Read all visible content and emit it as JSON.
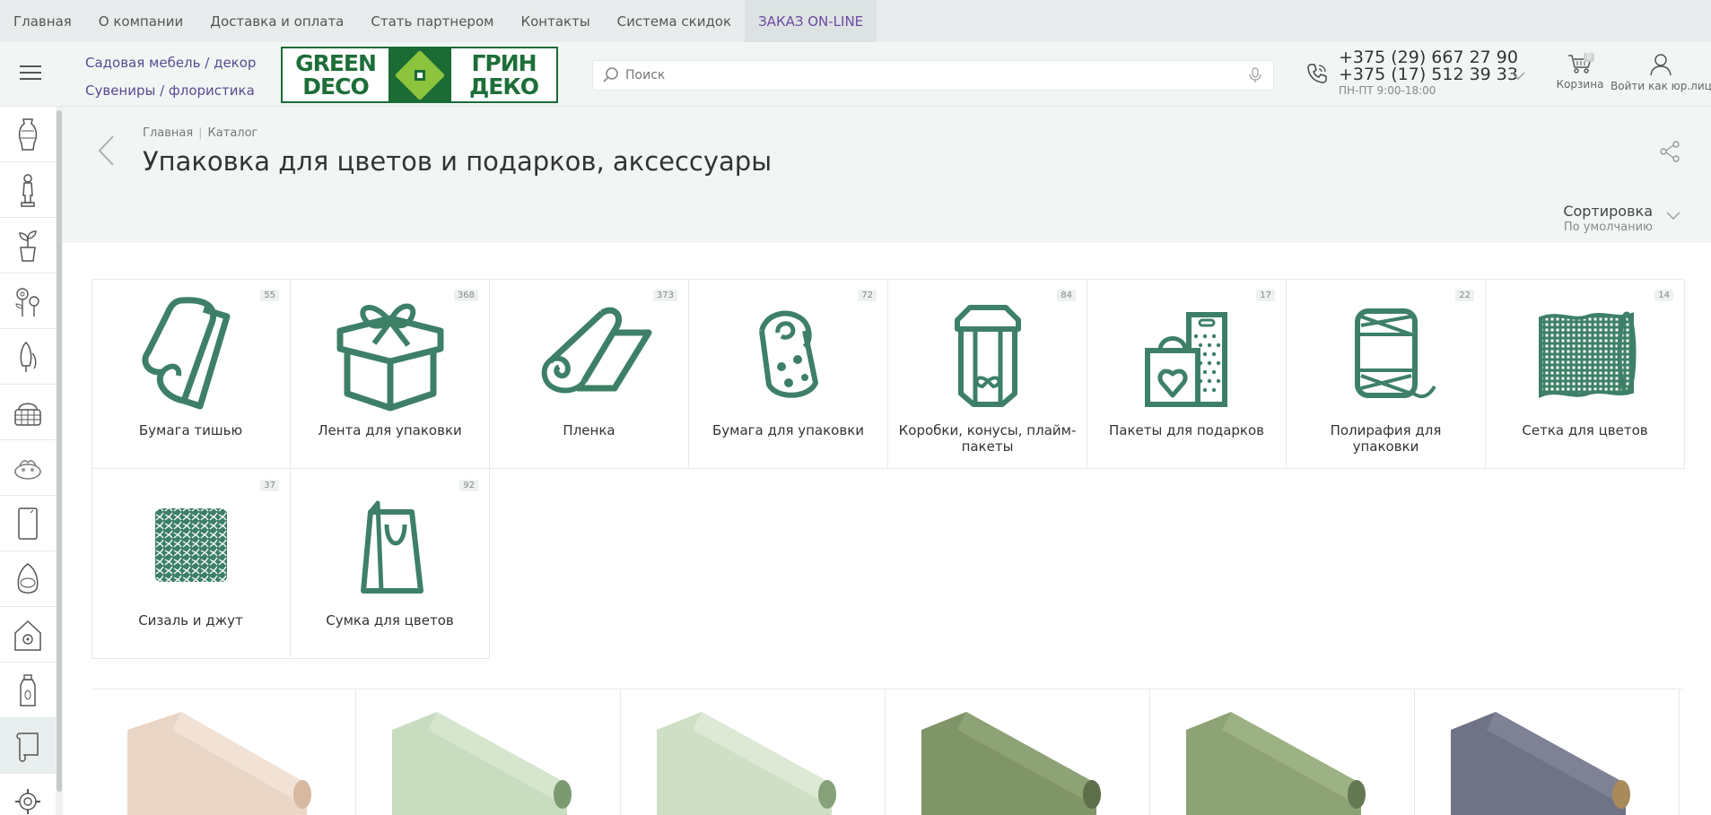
{
  "topnav": {
    "items": [
      {
        "label": "Главная"
      },
      {
        "label": "О компании"
      },
      {
        "label": "Доставка и оплата"
      },
      {
        "label": "Стать партнером"
      },
      {
        "label": "Контакты"
      },
      {
        "label": "Система скидок"
      },
      {
        "label": "ЗАКАЗ ON-LINE",
        "active": true
      }
    ]
  },
  "header": {
    "cat_links": [
      "Садовая мебель / декор",
      "Сувениры / флористика"
    ],
    "logo": {
      "left_line1": "GREEN",
      "left_line2": "DECO",
      "right_line1": "ГРИН",
      "right_line2": "ДЕКО"
    },
    "search_placeholder": "Поиск",
    "phones": [
      "+375 (29) 667 27 90",
      "+375 (17) 512 39 33"
    ],
    "hours": "ПН-ПТ 9:00-18:00",
    "cart_label": "Корзина",
    "cart_count": "0",
    "login_label": "Войти как юр.лицо"
  },
  "breadcrumb": [
    "Главная",
    "Каталог"
  ],
  "page_title": "Упаковка для цветов и подарков, аксессуары",
  "sort": {
    "label": "Сортировка",
    "value": "По умолчанию"
  },
  "categories": [
    {
      "name": "Бумага тишью",
      "count": "55",
      "icon": "tissue-paper-icon"
    },
    {
      "name": "Лента для упаковки",
      "count": "368",
      "icon": "gift-box-icon"
    },
    {
      "name": "Пленка",
      "count": "373",
      "icon": "film-roll-icon"
    },
    {
      "name": "Бумага для упаковки",
      "count": "72",
      "icon": "paper-roll-icon"
    },
    {
      "name": "Коробки, конусы, плайм-пакеты",
      "count": "84",
      "icon": "hat-box-icon"
    },
    {
      "name": "Пакеты для подарков",
      "count": "17",
      "icon": "gift-bags-icon"
    },
    {
      "name": "Полирафия для упаковки",
      "count": "22",
      "icon": "twine-spool-icon"
    },
    {
      "name": "Сетка для цветов",
      "count": "14",
      "icon": "mesh-roll-icon"
    },
    {
      "name": "Сизаль и джут",
      "count": "37",
      "icon": "sisal-icon"
    },
    {
      "name": "Сумка для цветов",
      "count": "92",
      "icon": "flower-bag-icon"
    }
  ],
  "colors": {
    "brand_green": "#3d8067",
    "logo_green": "#1b6b35",
    "accent_purple": "#6b4aa0",
    "header_bg": "#f1f6f5"
  },
  "sidebar_icons": [
    "vase-icon",
    "figurine-icon",
    "potted-plant-icon",
    "flowers-icon",
    "tree-icon",
    "basket-icon",
    "wreath-icon",
    "mirror-icon",
    "hanging-planter-icon",
    "house-gear-icon",
    "bottle-icon",
    "scroll-icon",
    "settings-icon"
  ],
  "products": [
    {
      "color": "#e8d3c2"
    },
    {
      "color": "#c8dcbf"
    },
    {
      "color": "#cfdfc6"
    },
    {
      "color": "#7f9467"
    },
    {
      "color": "#8ea375"
    },
    {
      "color": "#6f7385"
    }
  ]
}
